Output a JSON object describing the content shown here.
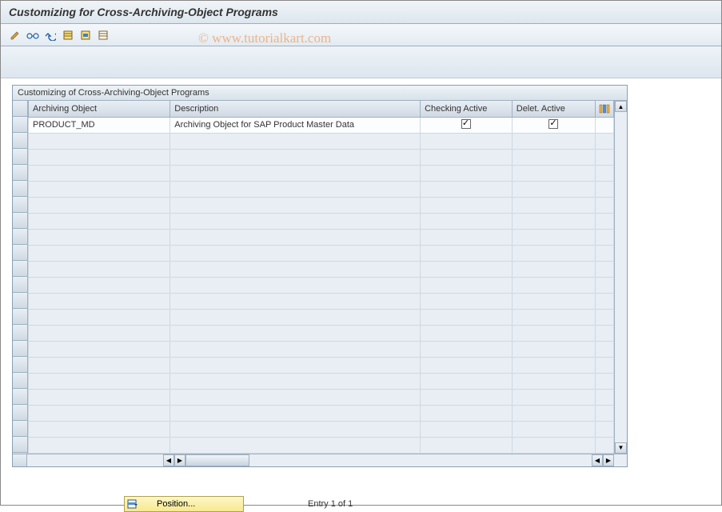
{
  "window": {
    "title": "Customizing for Cross-Archiving-Object Programs"
  },
  "watermark": "© www.tutorialkart.com",
  "toolbar": {
    "icons": [
      {
        "name": "change-icon"
      },
      {
        "name": "glasses-icon"
      },
      {
        "name": "undo-icon"
      },
      {
        "name": "select-all-icon"
      },
      {
        "name": "select-block-icon"
      },
      {
        "name": "deselect-icon"
      }
    ]
  },
  "table": {
    "panel_title": "Customizing of Cross-Archiving-Object Programs",
    "columns": {
      "archiving_object": "Archiving Object",
      "description": "Description",
      "checking_active": "Checking Active",
      "delet_active": "Delet. Active"
    },
    "rows": [
      {
        "archiving_object": "PRODUCT_MD",
        "description": "Archiving Object for SAP Product Master Data",
        "checking_active": true,
        "delet_active": true
      }
    ],
    "empty_rows": 20
  },
  "footer": {
    "position_button": "Position...",
    "entry_text": "Entry 1 of 1"
  }
}
